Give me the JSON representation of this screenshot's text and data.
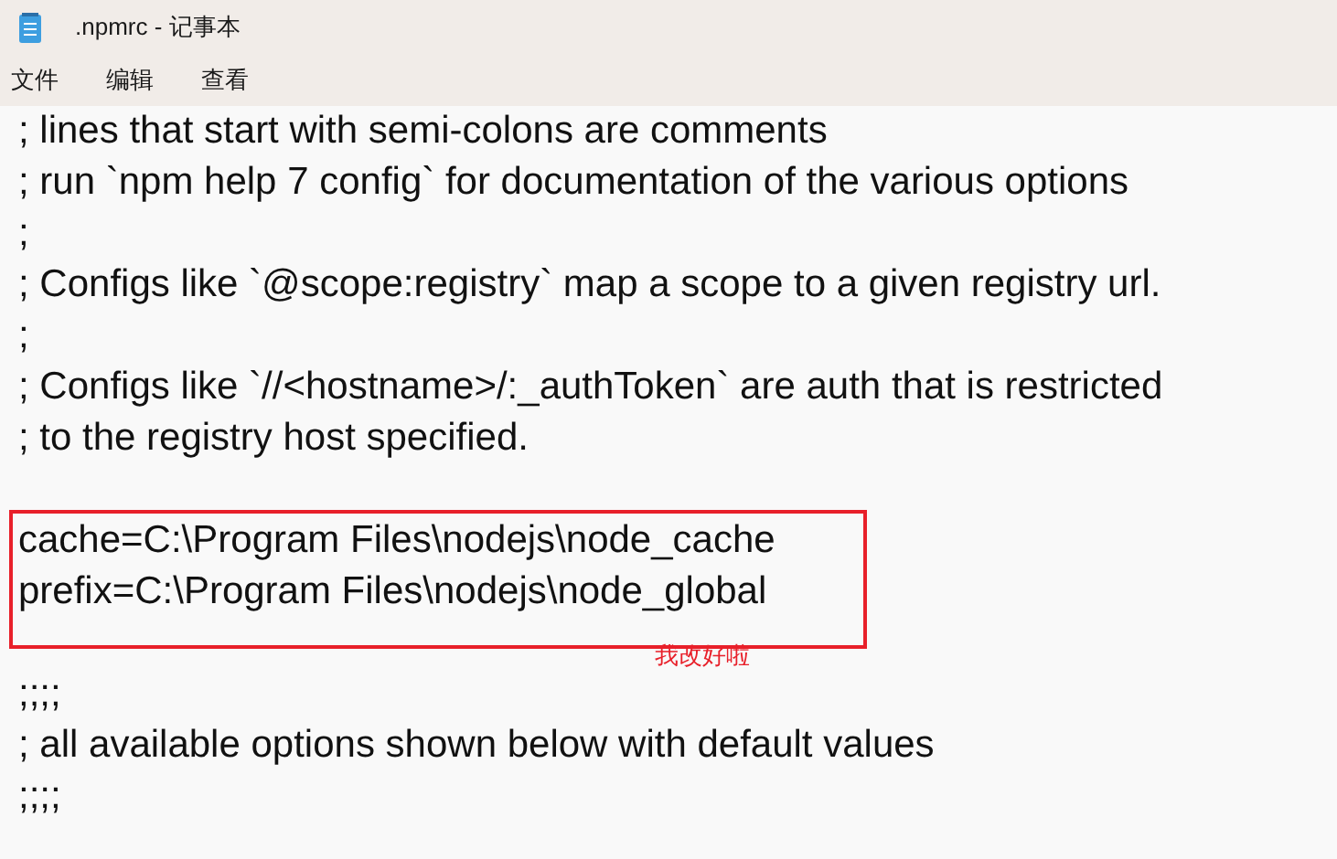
{
  "window": {
    "title": ".npmrc - 记事本"
  },
  "menu": [
    "文件",
    "编辑",
    "查看"
  ],
  "blocks": [
    {
      "kind": "plain",
      "lines": [
        {
          "kind": "text",
          "text": "; lines that start with semi-colons are comments"
        },
        {
          "kind": "text",
          "text": "; run `npm help 7 config` for documentation of the various options"
        },
        {
          "kind": "text",
          "text": ";"
        },
        {
          "kind": "text",
          "text": "; Configs like `@scope:registry` map a scope to a given registry url."
        },
        {
          "kind": "text",
          "text": ";"
        },
        {
          "kind": "text",
          "text": "; Configs like `//<hostname>/:_authToken` are auth that is restricted"
        },
        {
          "kind": "text",
          "text": "; to the registry host specified."
        },
        {
          "kind": "blank"
        }
      ]
    },
    {
      "kind": "highlight",
      "note": "我改好啦",
      "lines": [
        {
          "kind": "text",
          "text": "cache=C:\\Program Files\\nodejs\\node_cache"
        },
        {
          "kind": "text",
          "text": "prefix=C:\\Program Files\\nodejs\\node_global"
        }
      ]
    },
    {
      "kind": "plain",
      "lines": [
        {
          "kind": "blank"
        },
        {
          "kind": "text",
          "text": ";;;;"
        },
        {
          "kind": "text",
          "text": "; all available options shown below with default values"
        },
        {
          "kind": "text",
          "text": ";;;;"
        }
      ]
    }
  ]
}
